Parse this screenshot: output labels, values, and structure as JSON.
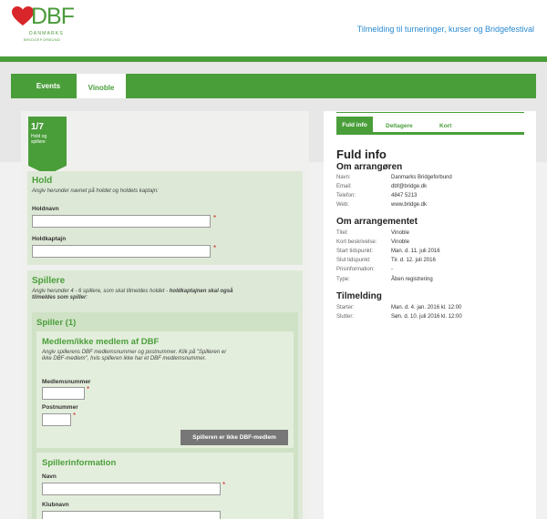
{
  "header": {
    "logo_main": "DBF",
    "logo_sub1": "DANMARKS",
    "logo_sub2": "BRIDGEFORBUND",
    "title": "Tilmelding til turneringer, kurser og Bridgefestival"
  },
  "nav": {
    "tabs": [
      {
        "label": "Events"
      },
      {
        "label": "Vinoble"
      }
    ]
  },
  "step": {
    "number": "1/7",
    "label_line1": "Hold og",
    "label_line2": "spillere"
  },
  "hold": {
    "title": "Hold",
    "desc": "Angiv herunder navnet på holdet og holdets kaptajn:",
    "holdnavn_label": "Holdnavn",
    "holdkaptajn_label": "Holdkaptajn"
  },
  "spillere": {
    "title": "Spillere",
    "desc_1": "Angiv herunder 4 - 6 spillere, som skal tilmeldes holdet - ",
    "desc_bold": "holdkaptajnen skal også",
    "desc_2_bold": "tilmeldes som spiller",
    "desc_2_end": ":"
  },
  "spiller1": {
    "title": "Spiller (1)",
    "member_title": "Medlem/ikke medlem af DBF",
    "member_desc_1": "Angiv spillerens DBF medlemsnummer og postnummer. Klik på \"Spilleren er",
    "member_desc_2": "ikke DBF-medlem\", hvis spilleren ikke har et DBF medlemsnummer.",
    "medlemsnummer_label": "Medlemsnummer",
    "postnummer_label": "Postnummer",
    "not_member_button": "Spilleren er ikke DBF-medlem",
    "info_title": "Spillerinformation",
    "navn_label": "Navn",
    "klubnavn_label": "Klubnavn"
  },
  "required_mark": "*",
  "right": {
    "tabs": [
      {
        "label": "Fuld info"
      },
      {
        "label": "Deltagere"
      },
      {
        "label": "Kort"
      }
    ],
    "heading": "Fuld info",
    "arrangor": {
      "title": "Om arrangøren",
      "rows": [
        {
          "k": "Navn:",
          "v": "Danmarks Bridgeforbund"
        },
        {
          "k": "Email:",
          "v": "dbf@bridge.dk"
        },
        {
          "k": "Telefon:",
          "v": "4847 5213"
        },
        {
          "k": "Web:",
          "v": "www.bridge.dk"
        }
      ]
    },
    "arrangement": {
      "title": "Om arrangementet",
      "rows": [
        {
          "k": "Titel:",
          "v": "Vinoble"
        },
        {
          "k": "Kort beskrivelse:",
          "v": "Vinoble"
        },
        {
          "k": "Start tidspunkt:",
          "v": "Man. d. 11. juli 2016"
        },
        {
          "k": "Slut tidspunkt:",
          "v": "Tir. d. 12. juli 2016"
        },
        {
          "k": "Prisinformation:",
          "v": "-"
        },
        {
          "k": "Type:",
          "v": "Åben registrering"
        }
      ]
    },
    "tilmelding": {
      "title": "Tilmelding",
      "rows": [
        {
          "k": "Starter:",
          "v": "Man. d. 4. jan. 2016 kl. 12:00"
        },
        {
          "k": "Slutter:",
          "v": "Søn. d. 10. juli 2016 kl. 12:00"
        }
      ]
    }
  }
}
